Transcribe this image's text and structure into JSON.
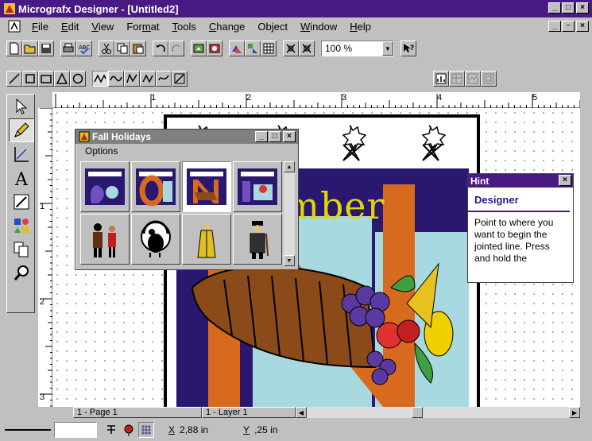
{
  "window": {
    "title": "Micrografx Designer - [Untitled2]",
    "buttons": [
      "_",
      "□",
      "×"
    ]
  },
  "menu": {
    "items": [
      {
        "label": "File",
        "key": "F"
      },
      {
        "label": "Edit",
        "key": "E"
      },
      {
        "label": "View",
        "key": "V"
      },
      {
        "label": "Format",
        "key": "m"
      },
      {
        "label": "Tools",
        "key": "T"
      },
      {
        "label": "Change",
        "key": "C"
      },
      {
        "label": "Object",
        "key": "j"
      },
      {
        "label": "Window",
        "key": "W"
      },
      {
        "label": "Help",
        "key": "H"
      }
    ],
    "doc_buttons": [
      "_",
      "▫",
      "×"
    ]
  },
  "toolbar": {
    "zoom_value": "100 %"
  },
  "rulers": {
    "h_numbers": [
      "1",
      "2",
      "3",
      "4",
      "5"
    ],
    "v_numbers": [
      "1",
      "2",
      "3"
    ]
  },
  "palette": {
    "title": "Fall Holidays",
    "menu": "Options"
  },
  "artwork": {
    "text": "ember"
  },
  "hint": {
    "title": "Hint",
    "heading": "Designer",
    "body": "Point to where you want to begin the jointed line. Press and hold the"
  },
  "scroll_tabs": {
    "page": "1 - Page 1",
    "layer": "1 - Layer 1"
  },
  "status": {
    "x_label": "X",
    "x_value": "2,88 in",
    "y_label": "Y",
    "y_value": ",25 in"
  },
  "colors": {
    "titlebar": "#4a1a84",
    "artwork_bg": "#2a1870",
    "letter_n": "#d86a20",
    "text_ember": "#e0d800"
  }
}
